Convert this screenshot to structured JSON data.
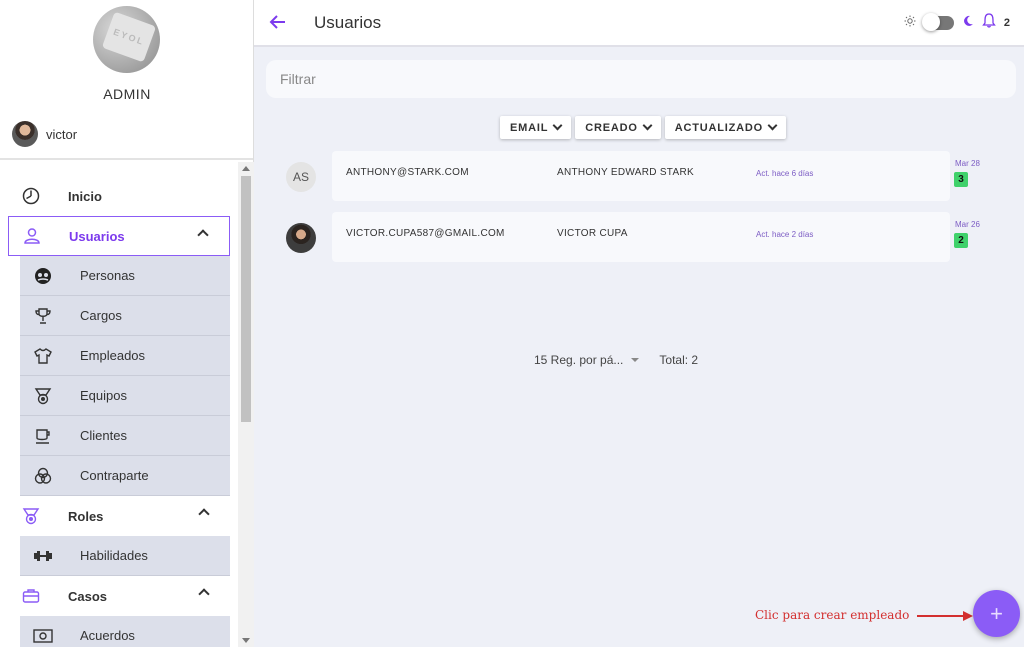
{
  "sidebar": {
    "brand": {
      "title": "ADMIN",
      "logo_text": "EYOL"
    },
    "user": {
      "name": "victor"
    },
    "menu": [
      {
        "label": "Inicio",
        "icon": "clock-icon"
      },
      {
        "label": "Usuarios",
        "icon": "user-icon",
        "active": true
      },
      {
        "label": "Personas",
        "icon": "people-icon",
        "sub": true
      },
      {
        "label": "Cargos",
        "icon": "trophy-icon",
        "sub": true
      },
      {
        "label": "Empleados",
        "icon": "shirt-icon",
        "sub": true
      },
      {
        "label": "Equipos",
        "icon": "medal-icon",
        "sub": true
      },
      {
        "label": "Clientes",
        "icon": "cup-icon",
        "sub": true
      },
      {
        "label": "Contraparte",
        "icon": "circles-icon",
        "sub": true
      },
      {
        "label": "Roles",
        "icon": "medal-icon"
      },
      {
        "label": "Habilidades",
        "icon": "dumbbell-icon",
        "sub": true
      },
      {
        "label": "Casos",
        "icon": "briefcase-icon"
      },
      {
        "label": "Acuerdos",
        "icon": "money-icon",
        "sub": true
      }
    ]
  },
  "header": {
    "title": "Usuarios",
    "notifications": "2"
  },
  "filter": {
    "placeholder": "Filtrar"
  },
  "sort_buttons": [
    "EMAIL",
    "CREADO",
    "ACTUALIZADO"
  ],
  "rows": [
    {
      "initials": "AS",
      "email": "ANTHONY@STARK.COM",
      "name": "ANTHONY EDWARD STARK",
      "updated": "Act. hace 6 días",
      "date": "Mar 28",
      "badge": "3"
    },
    {
      "initials": "",
      "email": "VICTOR.CUPA587@GMAIL.COM",
      "name": "VICTOR CUPA",
      "updated": "Act. hace 2 días",
      "date": "Mar 26",
      "badge": "2"
    }
  ],
  "pager": {
    "per_page": "15 Reg. por pá...",
    "total": "Total: 2"
  },
  "hint": "Clic para crear empleado",
  "fab": {
    "label": "+"
  },
  "colors": {
    "accent": "#8b5cf6",
    "badge": "#3fd16b",
    "hint": "#d32f2f"
  }
}
